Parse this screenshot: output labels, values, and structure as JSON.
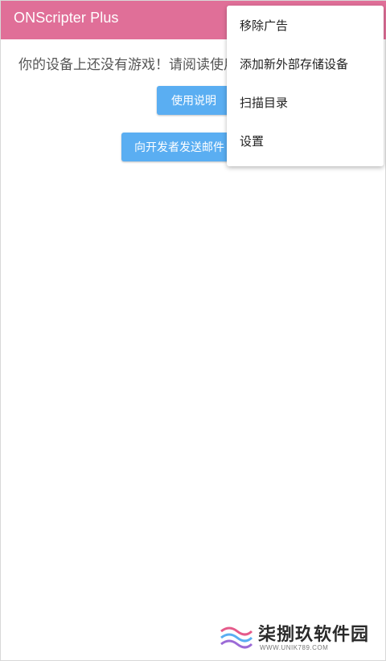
{
  "app_bar": {
    "title": "ONScripter Plus"
  },
  "main": {
    "message": "你的设备上还没有游戏！请阅读使用说明",
    "help_button": "使用说明",
    "mail_button": "向开发者发送邮件"
  },
  "overflow_menu": {
    "items": [
      "移除广告",
      "添加新外部存储设备",
      "扫描目录",
      "设置"
    ]
  },
  "watermark": {
    "text": "柒捌玖软件园",
    "sub": "WWW.UNIK789.COM"
  },
  "colors": {
    "app_bar": "#e06f98",
    "button": "#5aaef2",
    "text": "#555555"
  }
}
